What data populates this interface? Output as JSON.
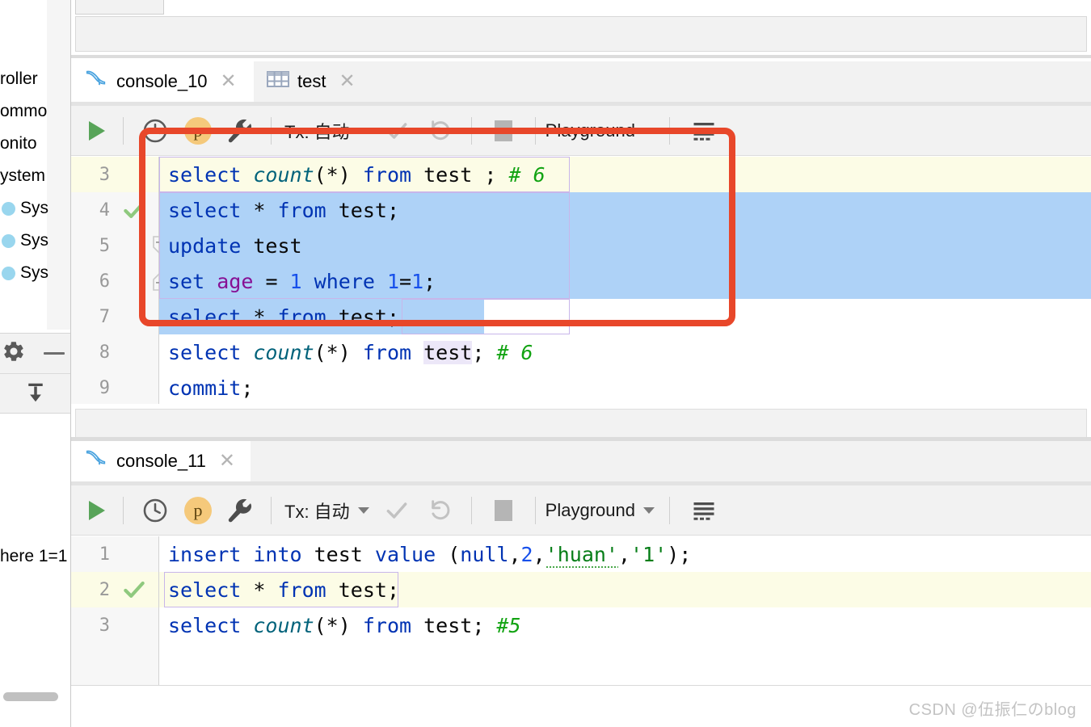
{
  "app": {
    "watermark": "CSDN @伍振仁のblog"
  },
  "left_sidebar": {
    "tree_items": [
      {
        "label": "roller",
        "bullet": false
      },
      {
        "label": "ommo",
        "bullet": false
      },
      {
        "label": "onito",
        "bullet": false
      },
      {
        "label": "ystem",
        "bullet": false
      },
      {
        "label": "Sys",
        "bullet": true
      },
      {
        "label": "Sys",
        "bullet": true
      },
      {
        "label": "Sys",
        "bullet": true
      }
    ],
    "icons": {
      "settings": "gear-icon",
      "minimize": "minimize-icon",
      "import": "import-icon"
    },
    "clipped_text": "here 1=1"
  },
  "console_10": {
    "tabs": [
      {
        "label": "console_10",
        "icon": "mysql-dolphin-icon",
        "active": true,
        "closable": true
      },
      {
        "label": "test",
        "icon": "table-icon",
        "active": false,
        "closable": true
      }
    ],
    "toolbar": {
      "run_label": "Run",
      "history_label": "History",
      "profile_badge": "p",
      "settings_label": "Settings",
      "tx_label": "Tx: 自动",
      "commit_label": "Commit",
      "rollback_label": "Rollback",
      "stop_label": "Stop",
      "schema_label": "Playground",
      "grid_label": "Output Format"
    },
    "lines": [
      {
        "number": "3",
        "marker": "",
        "fold": "",
        "caret": true,
        "tokens": [
          {
            "t": "select ",
            "c": "kw"
          },
          {
            "t": "count",
            "c": "fn"
          },
          {
            "t": "(*) ",
            "c": "plain"
          },
          {
            "t": "from ",
            "c": "kw"
          },
          {
            "t": "test ; ",
            "c": "plain"
          },
          {
            "t": "# 6",
            "c": "cmt"
          }
        ]
      },
      {
        "number": "4",
        "marker": "check",
        "fold": "",
        "caret": false,
        "tokens": [
          {
            "t": "select ",
            "c": "kw"
          },
          {
            "t": "* ",
            "c": "plain"
          },
          {
            "t": "from ",
            "c": "kw"
          },
          {
            "t": "test;",
            "c": "plain"
          }
        ]
      },
      {
        "number": "5",
        "marker": "",
        "fold": "collapse-top",
        "caret": false,
        "tokens": [
          {
            "t": "update ",
            "c": "kw"
          },
          {
            "t": "test",
            "c": "plain"
          }
        ]
      },
      {
        "number": "6",
        "marker": "",
        "fold": "collapse-bottom",
        "caret": false,
        "tokens": [
          {
            "t": "set ",
            "c": "kw"
          },
          {
            "t": "age ",
            "c": "col"
          },
          {
            "t": "= ",
            "c": "plain"
          },
          {
            "t": "1 ",
            "c": "num"
          },
          {
            "t": "where ",
            "c": "kw"
          },
          {
            "t": "1",
            "c": "num"
          },
          {
            "t": "=",
            "c": "plain"
          },
          {
            "t": "1",
            "c": "num"
          },
          {
            "t": ";",
            "c": "plain"
          }
        ]
      },
      {
        "number": "7",
        "marker": "",
        "fold": "",
        "caret": false,
        "tokens": [
          {
            "t": "select ",
            "c": "kw"
          },
          {
            "t": "* ",
            "c": "plain"
          },
          {
            "t": "from ",
            "c": "kw"
          },
          {
            "t": "test;",
            "c": "plain"
          }
        ]
      },
      {
        "number": "8",
        "marker": "",
        "fold": "",
        "caret": false,
        "tokens": [
          {
            "t": "select ",
            "c": "kw"
          },
          {
            "t": "count",
            "c": "fn"
          },
          {
            "t": "(*) ",
            "c": "plain"
          },
          {
            "t": "from ",
            "c": "kw"
          },
          {
            "t": "test",
            "c": "plain ident-hl"
          },
          {
            "t": "; ",
            "c": "plain"
          },
          {
            "t": "# 6",
            "c": "cmt"
          }
        ]
      },
      {
        "number": "9",
        "marker": "",
        "fold": "",
        "caret": false,
        "tokens": [
          {
            "t": "commit",
            "c": "kw"
          },
          {
            "t": ";",
            "c": "plain"
          }
        ]
      }
    ]
  },
  "console_11": {
    "tabs": [
      {
        "label": "console_11",
        "icon": "mysql-dolphin-icon",
        "active": true,
        "closable": true
      }
    ],
    "toolbar": {
      "run_label": "Run",
      "history_label": "History",
      "profile_badge": "p",
      "settings_label": "Settings",
      "tx_label": "Tx: 自动",
      "commit_label": "Commit",
      "rollback_label": "Rollback",
      "stop_label": "Stop",
      "schema_label": "Playground",
      "grid_label": "Output Format"
    },
    "lines": [
      {
        "number": "1",
        "marker": "",
        "caret": false,
        "tokens": [
          {
            "t": "insert into ",
            "c": "kw"
          },
          {
            "t": "test ",
            "c": "plain"
          },
          {
            "t": "value ",
            "c": "kw"
          },
          {
            "t": "(",
            "c": "plain"
          },
          {
            "t": "null",
            "c": "kw"
          },
          {
            "t": ",",
            "c": "plain"
          },
          {
            "t": "2",
            "c": "num"
          },
          {
            "t": ",",
            "c": "plain"
          },
          {
            "t": "'huan'",
            "c": "str squig"
          },
          {
            "t": ",",
            "c": "plain"
          },
          {
            "t": "'1'",
            "c": "str"
          },
          {
            "t": ");",
            "c": "plain"
          }
        ]
      },
      {
        "number": "2",
        "marker": "check",
        "caret": true,
        "tokens": [
          {
            "t": "select ",
            "c": "kw"
          },
          {
            "t": "* ",
            "c": "plain"
          },
          {
            "t": "from ",
            "c": "kw"
          },
          {
            "t": "test",
            "c": "plain"
          },
          {
            "t": ";",
            "c": "plain"
          }
        ]
      },
      {
        "number": "3",
        "marker": "",
        "caret": false,
        "tokens": [
          {
            "t": "select ",
            "c": "kw"
          },
          {
            "t": "count",
            "c": "fn"
          },
          {
            "t": "(*) ",
            "c": "plain"
          },
          {
            "t": "from ",
            "c": "kw"
          },
          {
            "t": "test; ",
            "c": "plain"
          },
          {
            "t": "#5",
            "c": "cmt"
          }
        ]
      }
    ]
  },
  "annotation": {
    "color": "#e8472a",
    "shape": "rounded-rectangle",
    "covers": "lines 3 through 7 of console_10"
  },
  "colors": {
    "selection": "#aed2f7",
    "caret_line": "#fcfce6",
    "keyword": "#0033b3",
    "function": "#00627a",
    "number": "#1750eb",
    "column": "#871094",
    "comment": "#12a312",
    "string": "#067d17",
    "accent_red": "#e8472a",
    "tab_underline": "#9aa7bd"
  }
}
